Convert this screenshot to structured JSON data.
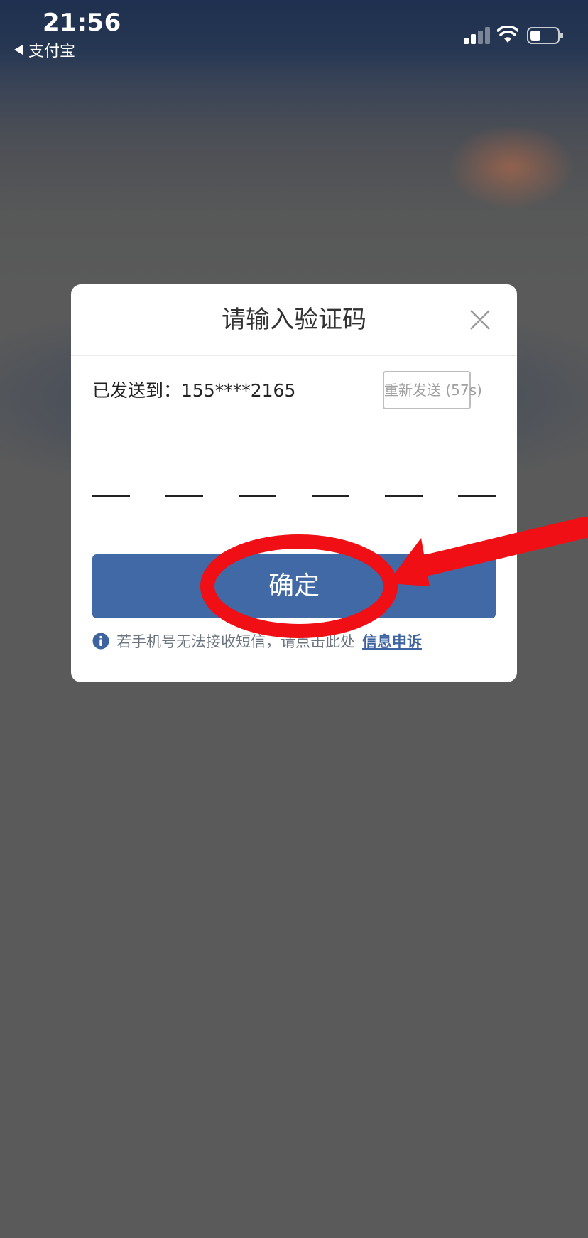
{
  "status_bar": {
    "time": "21:56",
    "back_app_label": "支付宝"
  },
  "dialog": {
    "title": "请输入验证码",
    "sent_to_label": "已发送到：",
    "phone_masked": "155****2165",
    "resend_label": "重新发送 (57s)",
    "code_length": 6,
    "confirm_label": "确定",
    "notice_text": "若手机号无法接收短信，请点击此处",
    "appeal_link": "信息申诉"
  },
  "colors": {
    "primary": "#4069a6",
    "annotation_red": "#ef0f14"
  },
  "icons": [
    "signal-icon",
    "wifi-icon",
    "battery-icon",
    "back-triangle-icon",
    "close-icon",
    "info-icon"
  ]
}
